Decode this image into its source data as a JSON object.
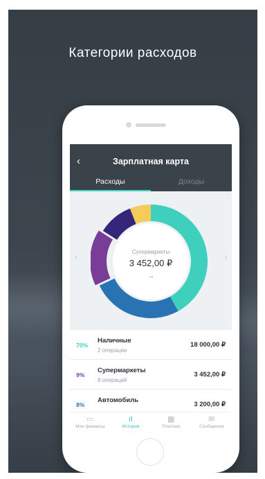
{
  "headline": "Категории расходов",
  "screen": {
    "back_icon": "‹",
    "title": "Зарплатная карта",
    "tabs": [
      {
        "label": "Расходы",
        "active": true
      },
      {
        "label": "Доходы",
        "active": false
      }
    ],
    "nav_left": "‹",
    "nav_right": "›"
  },
  "donut": {
    "center_label": "Супермаркеты",
    "center_value": "3 452,00 ₽",
    "center_arrow": "→",
    "segments": [
      {
        "name": "Наличные",
        "share": 0.42,
        "color": "#3ecfbd"
      },
      {
        "name": "blue",
        "share": 0.26,
        "color": "#2a73b3"
      },
      {
        "name": "Супермаркеты",
        "share": 0.16,
        "color": "#7a3d97",
        "selected": true
      },
      {
        "name": "dark",
        "share": 0.1,
        "color": "#35267a"
      },
      {
        "name": "yellow",
        "share": 0.06,
        "color": "#f5cc5a"
      }
    ]
  },
  "transactions": [
    {
      "pct": "70%",
      "pct_color": "#3ecfbd",
      "name": "Наличные",
      "ops": "2 операции",
      "amount": "18 000,00 ₽"
    },
    {
      "pct": "9%",
      "pct_color": "#7a3d97",
      "name": "Супермаркеты",
      "ops": "8 операций",
      "amount": "3 452,00 ₽"
    },
    {
      "pct": "8%",
      "pct_color": "#2a73b3",
      "name": "Автомобиль",
      "ops": "",
      "amount": "3 200,00 ₽"
    }
  ],
  "bottom_nav": [
    {
      "label": "Мои финансы",
      "icon": "wallet-icon",
      "glyph": "▭",
      "active": false
    },
    {
      "label": "История",
      "icon": "history-chart-icon",
      "glyph": "ıl",
      "active": true
    },
    {
      "label": "Платежи",
      "icon": "payments-grid-icon",
      "glyph": "▦",
      "active": false
    },
    {
      "label": "Сообщения",
      "icon": "messages-envelope-icon",
      "glyph": "✉",
      "active": false
    }
  ]
}
